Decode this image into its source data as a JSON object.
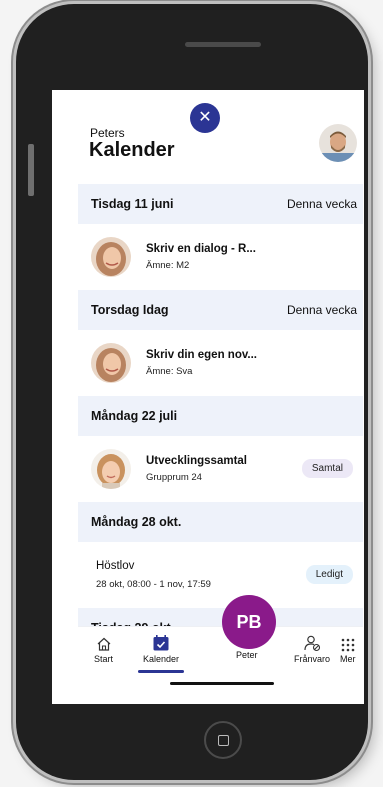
{
  "header": {
    "subtitle": "Peters",
    "title": "Kalender"
  },
  "sections": [
    {
      "heading": "Tisdag 11 juni",
      "week": "Denna vecka",
      "items": [
        {
          "title": "Skriv en dialog - R...",
          "subject": "Ämne: M2"
        }
      ]
    },
    {
      "heading": "Torsdag Idag",
      "week": "Denna vecka",
      "items": [
        {
          "title": "Skriv din egen nov...",
          "subject": "Ämne: Sva"
        }
      ]
    },
    {
      "heading": "Måndag 22 juli",
      "items": [
        {
          "title": "Utvecklingssamtal",
          "subject": "Grupprum 24",
          "badge": "Samtal"
        }
      ]
    },
    {
      "heading": "Måndag 28 okt.",
      "items": [
        {
          "title": "Höstlov",
          "subject": "28 okt, 08:00 - 1 nov, 17:59",
          "badge": "Ledigt"
        }
      ]
    },
    {
      "heading": "Tisdag 29 okt."
    }
  ],
  "tabbar": {
    "start": "Start",
    "kalender": "Kalender",
    "profile_initials": "PB",
    "profile_label": "Peter",
    "franvaro": "Frånvaro",
    "mer": "Mer"
  },
  "colors": {
    "accent": "#2b3594",
    "section_bg": "#eef2fa",
    "profile": "#8a1a8a",
    "badge_samtal": "#ece8f6",
    "badge_ledigt": "#e4f1fb"
  },
  "icons": [
    "close-icon",
    "home-icon",
    "calendar-icon",
    "person-absence-icon",
    "grid-icon"
  ]
}
